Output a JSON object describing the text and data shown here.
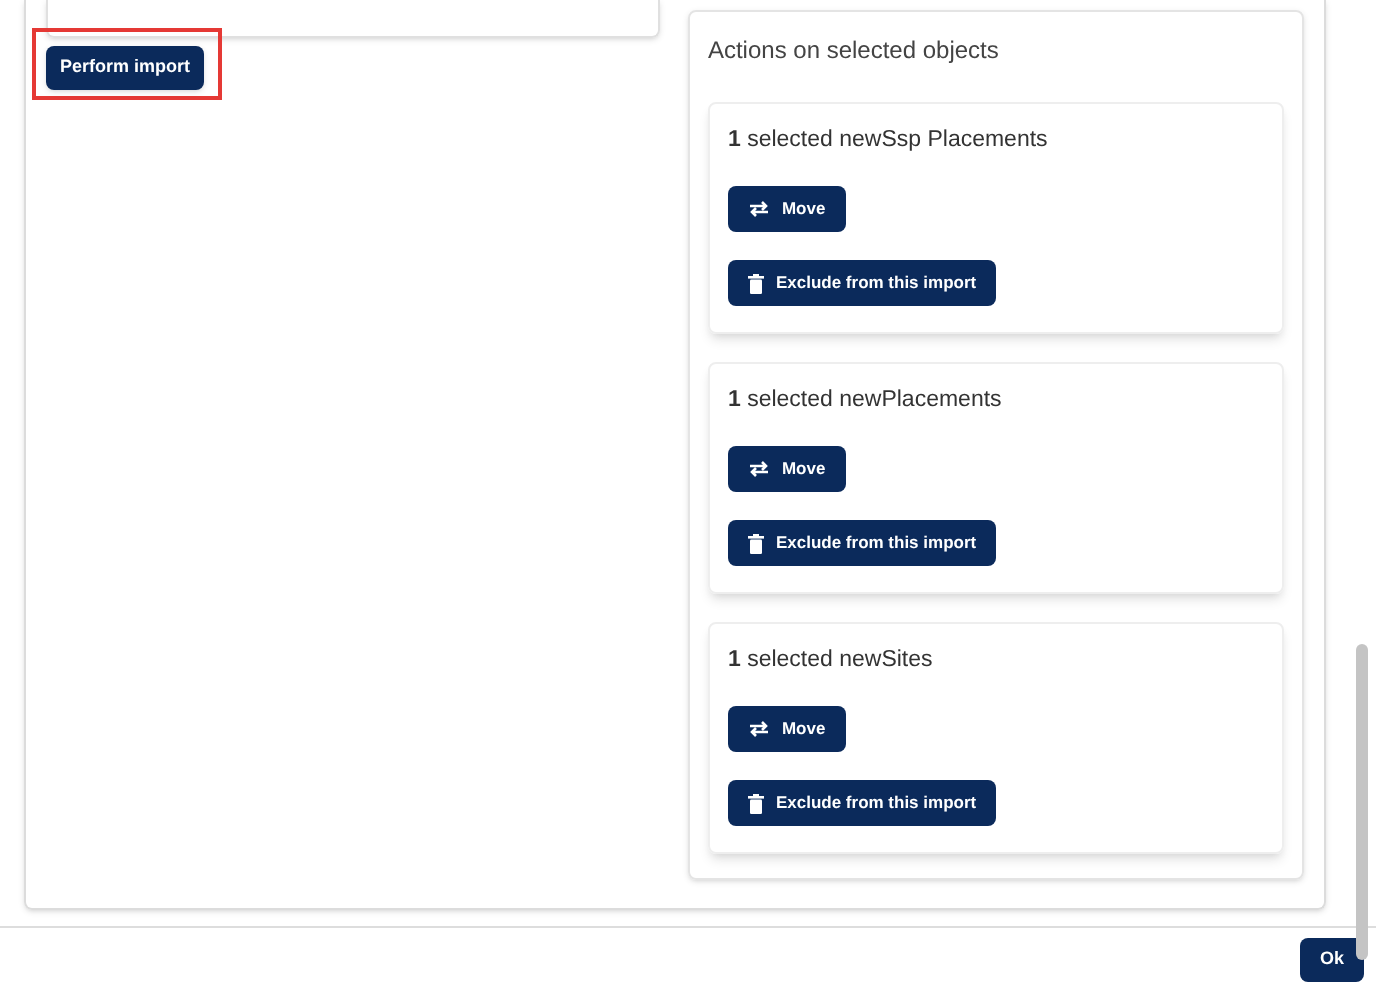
{
  "perform_import_button": "Perform import",
  "actions_panel": {
    "title": "Actions on selected objects",
    "groups": [
      {
        "count": "1",
        "label": "selected newSsp Placements",
        "buttons": [
          {
            "kind": "move",
            "label": "Move"
          },
          {
            "kind": "exclude",
            "label": "Exclude from this import"
          }
        ]
      },
      {
        "count": "1",
        "label": "selected newPlacements",
        "buttons": [
          {
            "kind": "move",
            "label": "Move"
          },
          {
            "kind": "exclude",
            "label": "Exclude from this import"
          }
        ]
      },
      {
        "count": "1",
        "label": "selected newSites",
        "buttons": [
          {
            "kind": "move",
            "label": "Move"
          },
          {
            "kind": "exclude",
            "label": "Exclude from this import"
          }
        ]
      }
    ]
  },
  "footer": {
    "ok_button": "Ok"
  }
}
